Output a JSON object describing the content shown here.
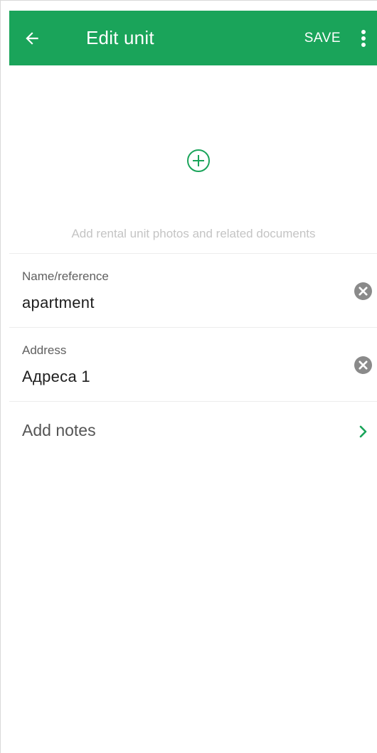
{
  "app_bar": {
    "title": "Edit unit",
    "save_label": "SAVE",
    "back_icon": "arrow-left-icon",
    "menu_icon": "more-vert-icon",
    "color": "#1aa45a"
  },
  "photos": {
    "add_icon": "add-circle-icon",
    "hint": "Add rental unit photos and related documents"
  },
  "fields": [
    {
      "label": "Name/reference",
      "value": "apartment",
      "clear_icon": "clear-icon"
    },
    {
      "label": "Address",
      "value": "Адреса 1",
      "clear_icon": "clear-icon"
    }
  ],
  "notes": {
    "label": "Add notes",
    "chevron_icon": "chevron-right-icon"
  }
}
